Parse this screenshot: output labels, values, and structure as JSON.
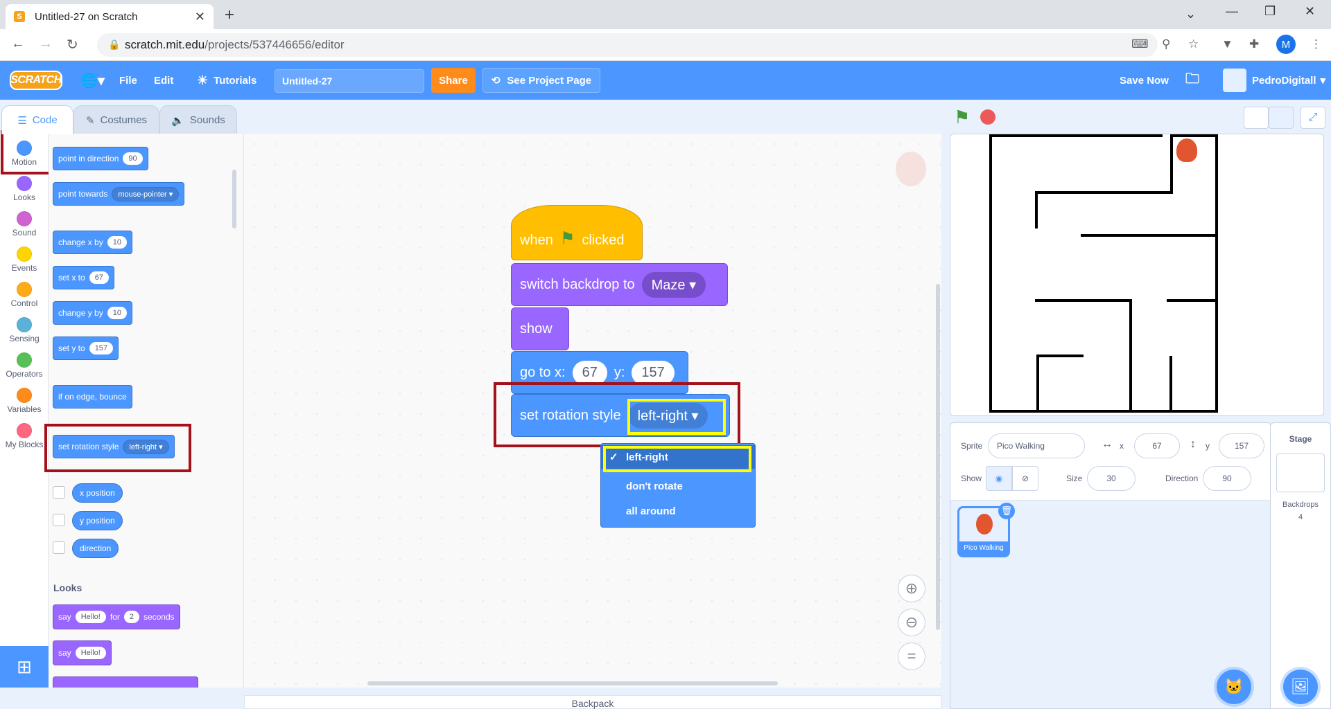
{
  "browser": {
    "tab_title": "Untitled-27 on Scratch",
    "url_domain": "scratch.mit.edu",
    "url_path": "/projects/537446656/editor",
    "profile_initial": "M"
  },
  "menubar": {
    "logo": "SCRATCH",
    "file": "File",
    "edit": "Edit",
    "tutorials": "Tutorials",
    "project_title": "Untitled-27",
    "share": "Share",
    "see_project_page": "See Project Page",
    "save_now": "Save Now",
    "username": "PedroDigitall"
  },
  "editor_tabs": {
    "code": "Code",
    "costumes": "Costumes",
    "sounds": "Sounds"
  },
  "categories": [
    {
      "label": "Motion",
      "color": "#4c97ff"
    },
    {
      "label": "Looks",
      "color": "#9966ff"
    },
    {
      "label": "Sound",
      "color": "#cf63cf"
    },
    {
      "label": "Events",
      "color": "#ffd500"
    },
    {
      "label": "Control",
      "color": "#ffab19"
    },
    {
      "label": "Sensing",
      "color": "#5cb1d6"
    },
    {
      "label": "Operators",
      "color": "#59c059"
    },
    {
      "label": "Variables",
      "color": "#ff8c1a"
    },
    {
      "label": "My Blocks",
      "color": "#ff6680"
    }
  ],
  "palette": {
    "point_in_direction": "point in direction",
    "point_in_direction_val": "90",
    "point_towards": "point towards",
    "point_towards_val": "mouse-pointer",
    "change_x_by": "change x by",
    "change_x_val": "10",
    "set_x_to": "set x to",
    "set_x_val": "67",
    "change_y_by": "change y by",
    "change_y_val": "10",
    "set_y_to": "set y to",
    "set_y_val": "157",
    "if_on_edge": "if on edge, bounce",
    "set_rotation": "set rotation style",
    "set_rotation_val": "left-right",
    "x_position": "x position",
    "y_position": "y position",
    "direction": "direction",
    "looks_header": "Looks",
    "say_for": "say",
    "say_for_val": "Hello!",
    "say_for_for": "for",
    "say_for_secs": "2",
    "say_for_seconds": "seconds",
    "say": "say",
    "say_val": "Hello!"
  },
  "script": {
    "when": "when",
    "clicked": "clicked",
    "switch_backdrop": "switch backdrop to",
    "backdrop_val": "Maze",
    "show": "show",
    "go_to_x": "go to x:",
    "x_val": "67",
    "y_label": "y:",
    "y_val": "157",
    "set_rotation": "set rotation style",
    "rotation_val": "left-right"
  },
  "dropdown": {
    "options": [
      "left-right",
      "don't rotate",
      "all around"
    ],
    "selected": "left-right"
  },
  "backpack": "Backpack",
  "sprite_info": {
    "sprite_label": "Sprite",
    "sprite_name": "Pico Walking",
    "x_label": "x",
    "x": "67",
    "y_label": "y",
    "y": "157",
    "show_label": "Show",
    "size_label": "Size",
    "size": "30",
    "direction_label": "Direction",
    "direction": "90"
  },
  "sprite_thumb": "Pico Walking",
  "stage_panel": {
    "title": "Stage",
    "backdrops_label": "Backdrops",
    "backdrops_count": "4"
  },
  "colors": {
    "accent": "#4c97ff",
    "highlight_red": "#a3111a",
    "highlight_yellow": "#ffff00"
  }
}
